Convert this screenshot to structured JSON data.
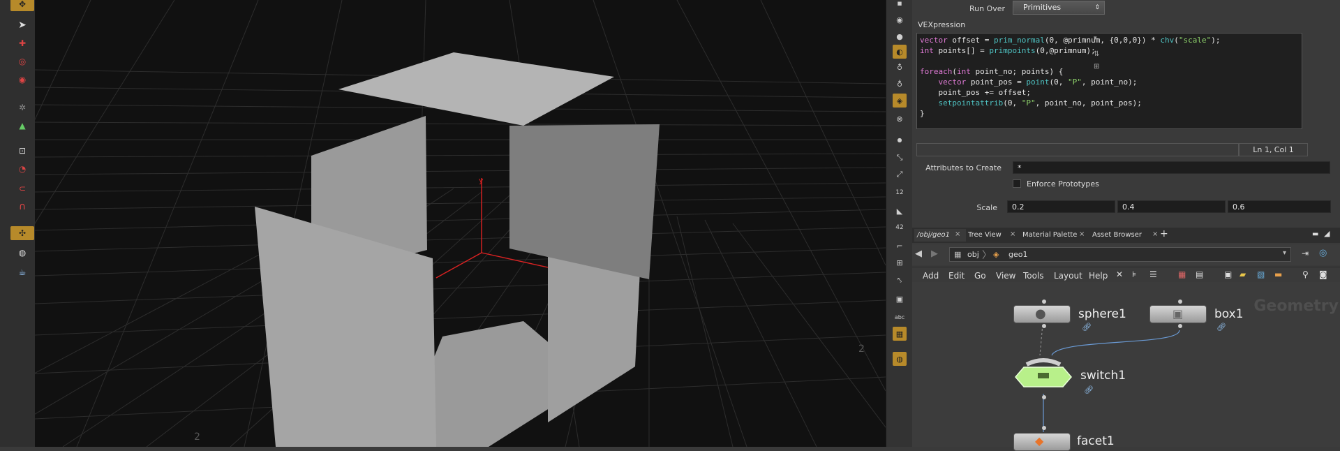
{
  "params": {
    "run_over_label": "Run Over",
    "run_over_value": "Primitives",
    "vex_label": "VEXpression",
    "code_lines": [
      "vector offset = prim_normal(0, @primnum, {0,0,0}) * chv(\"scale\");",
      "int points[] = primpoints(0,@primnum);",
      "",
      "foreach(int point_no; points) {",
      "    vector point_pos = point(0, \"P\", point_no);",
      "    point_pos += offset;",
      "    setpointattrib(0, \"P\", point_no, point_pos);",
      "}"
    ],
    "cursor_pos": "Ln 1, Col 1",
    "attributes_label": "Attributes to Create",
    "attributes_value": "*",
    "enforce_label": "Enforce Prototypes",
    "scale_label": "Scale",
    "scale_values": [
      "0.2",
      "0.4",
      "0.6"
    ]
  },
  "tabs": [
    "/obj/geo1",
    "Tree View",
    "Material Palette",
    "Asset Browser"
  ],
  "path": {
    "root": "obj",
    "current": "geo1"
  },
  "menu": [
    "Add",
    "Edit",
    "Go",
    "View",
    "Tools",
    "Layout",
    "Help"
  ],
  "network": {
    "context_label": "Geometry",
    "nodes": [
      "sphere1",
      "box1",
      "switch1",
      "facet1"
    ]
  },
  "viewport": {
    "axis_labels": [
      "y",
      "2",
      "2"
    ]
  },
  "colors": {
    "accent": "#b78a2a",
    "switch_node": "#b8f08a"
  }
}
